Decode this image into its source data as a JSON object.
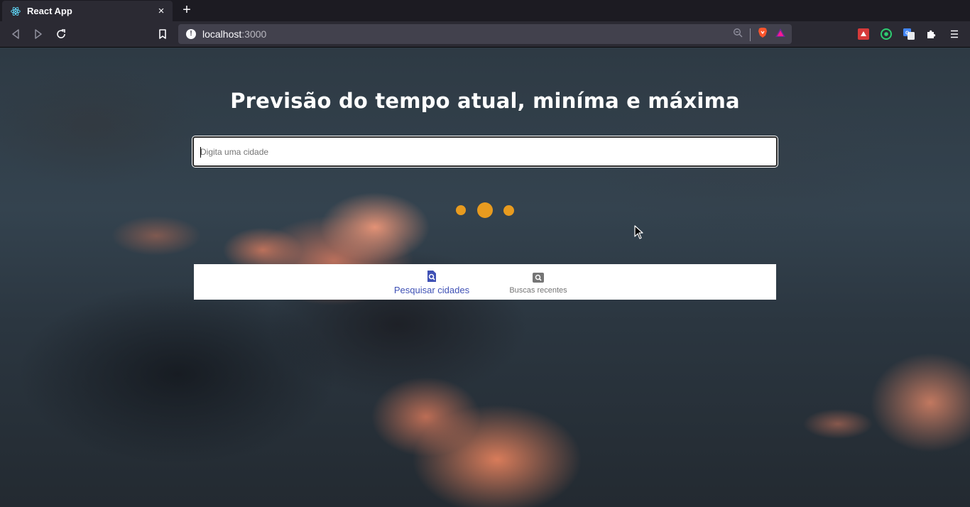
{
  "browser": {
    "tab_title": "React App",
    "tab_close": "×",
    "new_tab": "+",
    "url_host": "localhost",
    "url_port": ":3000",
    "info_icon": "!"
  },
  "page": {
    "headline": "Previsão do tempo atual, miníma e máxima",
    "search_placeholder": "Digita uma cidade",
    "loading": true
  },
  "bottom_nav": {
    "items": [
      {
        "label": "Pesquisar cidades",
        "icon": "search-file-icon",
        "active": true
      },
      {
        "label": "Buscas recentes",
        "icon": "image-search-icon",
        "active": false
      }
    ]
  },
  "colors": {
    "accent": "#3f51b5",
    "loader": "#e89b1f",
    "inactive": "#757575"
  }
}
